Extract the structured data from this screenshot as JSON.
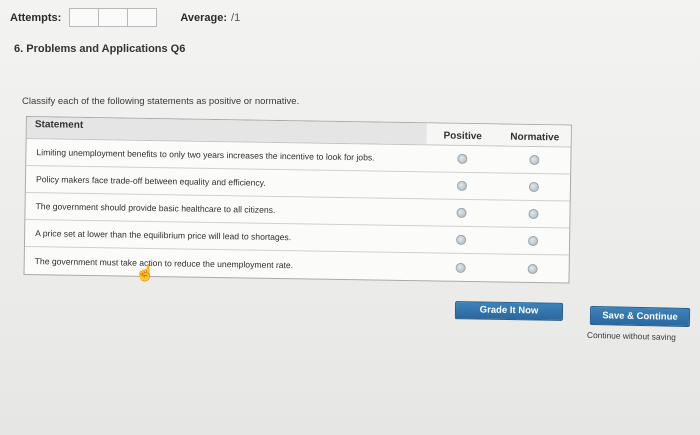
{
  "header": {
    "attempts_label": "Attempts:",
    "average_label": "Average:",
    "average_value": "/1"
  },
  "problem": {
    "title": "6. Problems and Applications Q6",
    "instructions": "Classify each of the following statements as positive or normative."
  },
  "table": {
    "headers": {
      "statement": "Statement",
      "positive": "Positive",
      "normative": "Normative"
    },
    "rows": [
      {
        "statement": "Limiting unemployment benefits to only two years increases the incentive to look for jobs."
      },
      {
        "statement": "Policy makers face trade-off between equality and efficiency."
      },
      {
        "statement": "The government should provide basic healthcare to all citizens."
      },
      {
        "statement": "A price set at lower than the equilibrium price will lead to shortages."
      },
      {
        "statement": "The government must take action to reduce the unemployment rate."
      }
    ]
  },
  "buttons": {
    "grade": "Grade It Now",
    "save": "Save & Continue",
    "continue_without_saving": "Continue without saving"
  },
  "colors": {
    "button_blue": "#2f72ab",
    "radio_gray": "#b9c3c9"
  }
}
